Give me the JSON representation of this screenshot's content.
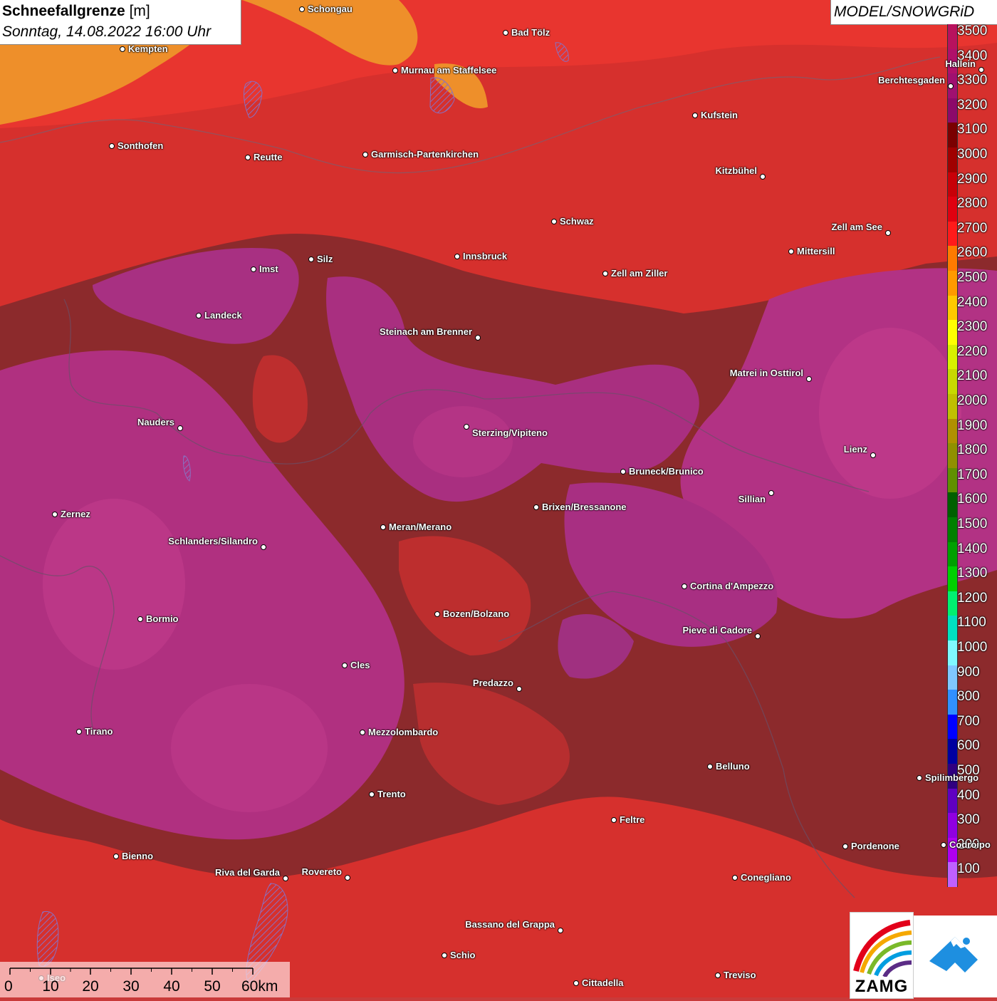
{
  "title": {
    "parameter": "Schneefallgrenze",
    "unit": "[m]",
    "datetime": "Sonntag, 14.08.2022 16:00 Uhr"
  },
  "model_label": "MODEL/SNOWGRiD",
  "legend": {
    "levels": [
      {
        "label": "3500",
        "color": "#b8125e"
      },
      {
        "label": "3400",
        "color": "#b0106a"
      },
      {
        "label": "3300",
        "color": "#a01070"
      },
      {
        "label": "3200",
        "color": "#8c0a6a"
      },
      {
        "label": "3100",
        "color": "#7a0000"
      },
      {
        "label": "3000",
        "color": "#a00000"
      },
      {
        "label": "2900",
        "color": "#c80008"
      },
      {
        "label": "2800",
        "color": "#e00010"
      },
      {
        "label": "2700",
        "color": "#ff1a1a"
      },
      {
        "label": "2600",
        "color": "#ff7a00"
      },
      {
        "label": "2500",
        "color": "#ff9a00"
      },
      {
        "label": "2400",
        "color": "#ffc800"
      },
      {
        "label": "2300",
        "color": "#ffff00"
      },
      {
        "label": "2200",
        "color": "#d8f000"
      },
      {
        "label": "2100",
        "color": "#c8d800"
      },
      {
        "label": "2000",
        "color": "#c0c000"
      },
      {
        "label": "1900",
        "color": "#b09000"
      },
      {
        "label": "1800",
        "color": "#909000"
      },
      {
        "label": "1700",
        "color": "#609000"
      },
      {
        "label": "1600",
        "color": "#006000"
      },
      {
        "label": "1500",
        "color": "#008000"
      },
      {
        "label": "1400",
        "color": "#00a000"
      },
      {
        "label": "1300",
        "color": "#00d000"
      },
      {
        "label": "1200",
        "color": "#00f070"
      },
      {
        "label": "1100",
        "color": "#00e0c0"
      },
      {
        "label": "1000",
        "color": "#80f8ff"
      },
      {
        "label": "900",
        "color": "#80c8ff"
      },
      {
        "label": "800",
        "color": "#3090ff"
      },
      {
        "label": "700",
        "color": "#0000ff"
      },
      {
        "label": "600",
        "color": "#0000a0"
      },
      {
        "label": "500",
        "color": "#300080"
      },
      {
        "label": "400",
        "color": "#6000c0"
      },
      {
        "label": "300",
        "color": "#9000e0"
      },
      {
        "label": "200",
        "color": "#b000f0"
      },
      {
        "label": "100",
        "color": "#c060ff"
      }
    ]
  },
  "cities": [
    {
      "name": "Schongau"
    },
    {
      "name": "Kempten"
    },
    {
      "name": "Bad Tölz"
    },
    {
      "name": "Murnau am Staffelsee"
    },
    {
      "name": "Hallein"
    },
    {
      "name": "Berchtesgaden"
    },
    {
      "name": "Kufstein"
    },
    {
      "name": "Sonthofen"
    },
    {
      "name": "Reutte"
    },
    {
      "name": "Garmisch-Partenkirchen"
    },
    {
      "name": "Kitzbühel"
    },
    {
      "name": "Schwaz"
    },
    {
      "name": "Zell am See"
    },
    {
      "name": "Innsbruck"
    },
    {
      "name": "Mittersill"
    },
    {
      "name": "Imst"
    },
    {
      "name": "Silz"
    },
    {
      "name": "Zell am Ziller"
    },
    {
      "name": "Landeck"
    },
    {
      "name": "Steinach am Brenner"
    },
    {
      "name": "Matrei in Osttirol"
    },
    {
      "name": "Nauders"
    },
    {
      "name": "Sterzing/Vipiteno"
    },
    {
      "name": "Lienz"
    },
    {
      "name": "Bruneck/Brunico"
    },
    {
      "name": "Sillian"
    },
    {
      "name": "Brixen/Bressanone"
    },
    {
      "name": "Zernez"
    },
    {
      "name": "Meran/Merano"
    },
    {
      "name": "Schlanders/Silandro"
    },
    {
      "name": "Cortina d'Ampezzo"
    },
    {
      "name": "Bozen/Bolzano"
    },
    {
      "name": "Bormio"
    },
    {
      "name": "Pieve di Cadore"
    },
    {
      "name": "Cles"
    },
    {
      "name": "Predazzo"
    },
    {
      "name": "Tirano"
    },
    {
      "name": "Mezzolombardo"
    },
    {
      "name": "Belluno"
    },
    {
      "name": "Spilimbergo"
    },
    {
      "name": "Trento"
    },
    {
      "name": "Feltre"
    },
    {
      "name": "Pordenone"
    },
    {
      "name": "Codroipo"
    },
    {
      "name": "Bienno"
    },
    {
      "name": "Riva del Garda"
    },
    {
      "name": "Rovereto"
    },
    {
      "name": "Conegliano"
    },
    {
      "name": "Bassano del Grappa"
    },
    {
      "name": "Schio"
    },
    {
      "name": "Treviso"
    },
    {
      "name": "Cittadella"
    },
    {
      "name": "Iseo"
    }
  ],
  "scale_bar": {
    "ticks": [
      "0",
      "10",
      "20",
      "30",
      "40",
      "50",
      "60km"
    ]
  },
  "logos": {
    "zamg": "ZAMG",
    "snow": "snowgrid-mountain-icon"
  },
  "colors": {
    "dominant_red": "#d8302e",
    "dark_red": "#8a2a2a",
    "magenta": "#b0307a",
    "orange": "#f0922a"
  }
}
